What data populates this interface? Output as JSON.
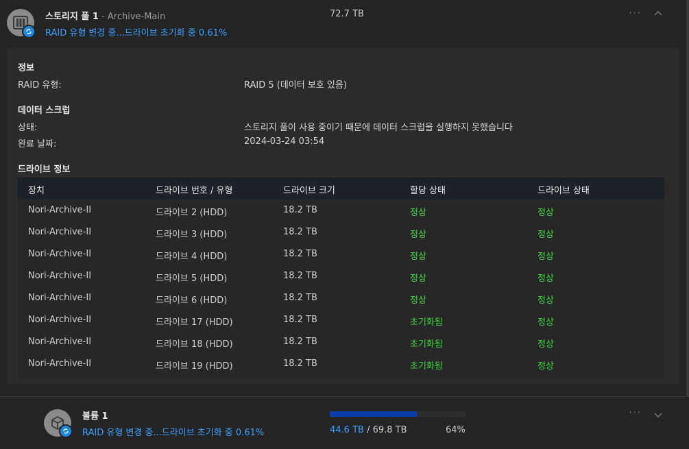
{
  "pool": {
    "title": "스토리지 풀 1",
    "separator": " - ",
    "name": "Archive-Main",
    "status": "RAID 유형 변경 중...드라이브 초기화 중 0.61%",
    "size": "72.7 TB",
    "icon": "storage-pool-icon",
    "badge_icon": "sync-icon",
    "more_icon": "more-horizontal-icon",
    "collapse_icon": "chevron-up-icon"
  },
  "info": {
    "section_title": "정보",
    "raid_type_label": "RAID 유형:",
    "raid_type_value": "RAID 5 (데이터 보호 있음)"
  },
  "scrub": {
    "section_title": "데이터 스크럽",
    "status_label": "상태:",
    "status_value": "스토리지 풀이 사용 중이기 때문에 데이터 스크럽을 실행하지 못했습니다",
    "date_label": "완료 날짜:",
    "date_value": "2024-03-24 03:54"
  },
  "drives": {
    "section_title": "드라이브 정보",
    "headers": [
      "장치",
      "드라이브 번호 / 유형",
      "드라이브 크기",
      "할당 상태",
      "드라이브 상태"
    ],
    "rows": [
      [
        "Nori-Archive-II",
        "드라이브 2 (HDD)",
        "18.2 TB",
        "정상",
        "정상"
      ],
      [
        "Nori-Archive-II",
        "드라이브 3 (HDD)",
        "18.2 TB",
        "정상",
        "정상"
      ],
      [
        "Nori-Archive-II",
        "드라이브 4 (HDD)",
        "18.2 TB",
        "정상",
        "정상"
      ],
      [
        "Nori-Archive-II",
        "드라이브 5 (HDD)",
        "18.2 TB",
        "정상",
        "정상"
      ],
      [
        "Nori-Archive-II",
        "드라이브 6 (HDD)",
        "18.2 TB",
        "정상",
        "정상"
      ],
      [
        "Nori-Archive-II",
        "드라이브 17 (HDD)",
        "18.2 TB",
        "초기화됨",
        "정상"
      ],
      [
        "Nori-Archive-II",
        "드라이브 18 (HDD)",
        "18.2 TB",
        "초기화됨",
        "정상"
      ],
      [
        "Nori-Archive-II",
        "드라이브 19 (HDD)",
        "18.2 TB",
        "초기화됨",
        "정상"
      ]
    ]
  },
  "volume": {
    "title": "볼륨 1",
    "status": "RAID 유형 변경 중...드라이브 초기화 중 0.61%",
    "used": "44.6 TB",
    "slash": " / ",
    "total": "69.8 TB",
    "percent_label": "64%",
    "usage_fraction": 0.64,
    "icon": "volume-cube-icon",
    "badge_icon": "sync-icon",
    "more_icon": "more-horizontal-icon",
    "expand_icon": "chevron-down-icon"
  },
  "colors": {
    "accent_blue": "#3aa0ff",
    "status_green": "#3ddc3d",
    "progress_fill": "#0b3da8",
    "badge_blue": "#1e88e5"
  }
}
